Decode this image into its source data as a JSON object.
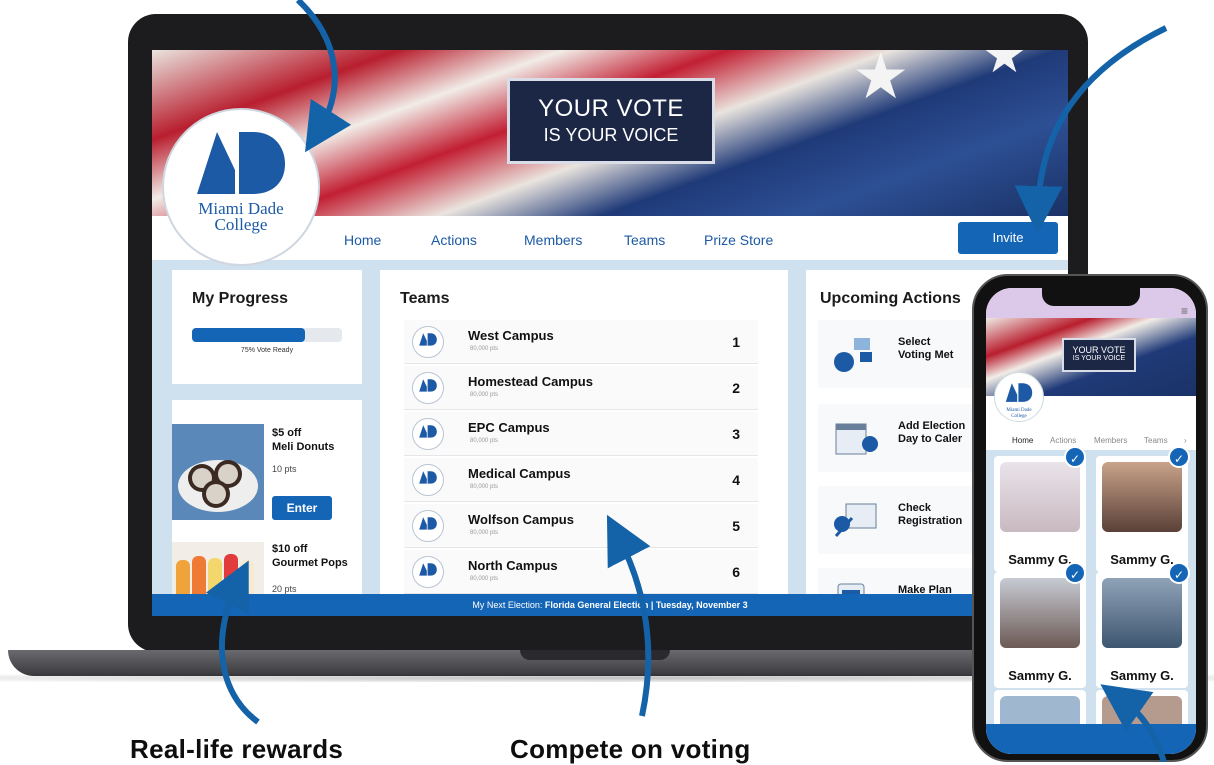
{
  "colors": {
    "accent": "#1565b6",
    "brand": "#1c5aa6",
    "panel_bg": "#cfe0ef"
  },
  "banner": {
    "headline": "YOUR VOTE",
    "subheadline": "IS YOUR VOICE"
  },
  "logo": {
    "line1": "Miami Dade",
    "line2": "College"
  },
  "nav": {
    "items": [
      "Home",
      "Actions",
      "Members",
      "Teams",
      "Prize Store"
    ],
    "invite_label": "Invite"
  },
  "progress": {
    "title": "My Progress",
    "label": "75% Vote Ready",
    "value": 0.75
  },
  "rewards": [
    {
      "title_line1": "$5 off",
      "title_line2": "Meli Donuts",
      "pts": "10 pts",
      "button": "Enter"
    },
    {
      "title_line1": "$10 off",
      "title_line2": "Gourmet Pops",
      "pts": "20 pts"
    }
  ],
  "teams": {
    "title": "Teams",
    "rows": [
      {
        "name": "West Campus",
        "pts": "80,000 pts",
        "rank": "1"
      },
      {
        "name": "Homestead Campus",
        "pts": "80,000 pts",
        "rank": "2"
      },
      {
        "name": "EPC Campus",
        "pts": "80,000 pts",
        "rank": "3"
      },
      {
        "name": "Medical Campus",
        "pts": "80,000 pts",
        "rank": "4"
      },
      {
        "name": "Wolfson Campus",
        "pts": "80,000 pts",
        "rank": "5"
      },
      {
        "name": "North Campus",
        "pts": "80,000 pts",
        "rank": "6"
      }
    ]
  },
  "actions": {
    "title": "Upcoming Actions",
    "rows": [
      {
        "label": "Select\nVoting Met"
      },
      {
        "label": "Add Election\nDay to Caler"
      },
      {
        "label": "Check\nRegistration"
      },
      {
        "label": "Make Plan"
      }
    ]
  },
  "footer": {
    "prefix": "My Next Election: ",
    "election": "Florida General Election | Tuesday, November 3"
  },
  "phone": {
    "banner_headline": "YOUR VOTE",
    "banner_sub": "IS YOUR VOICE",
    "logo_line1": "Miami Dade",
    "logo_line2": "College",
    "nav": [
      "Home",
      "Actions",
      "Members",
      "Teams"
    ],
    "members": [
      {
        "name": "Sammy G."
      },
      {
        "name": "Sammy G."
      },
      {
        "name": "Sammy G."
      },
      {
        "name": "Sammy G."
      }
    ]
  },
  "captions": {
    "rewards": "Real-life rewards",
    "compete": "Compete on voting"
  }
}
